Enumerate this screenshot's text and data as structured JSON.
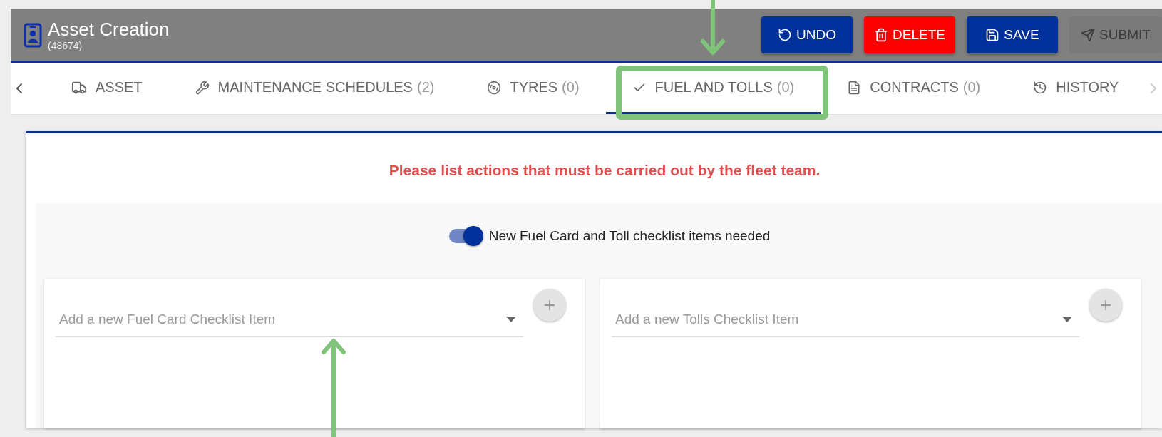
{
  "header": {
    "title": "Asset Creation",
    "subtitle": "(48674)"
  },
  "actions": [
    {
      "kind": "undo",
      "label": "UNDO",
      "disabled": false
    },
    {
      "kind": "delete",
      "label": "DELETE",
      "disabled": false
    },
    {
      "kind": "save",
      "label": "SAVE",
      "disabled": false
    },
    {
      "kind": "submit",
      "label": "SUBMIT",
      "disabled": true
    }
  ],
  "tabs": [
    {
      "label": "ASSET",
      "selected": false
    },
    {
      "label": "MAINTENANCE SCHEDULES",
      "count": "(2)",
      "selected": false
    },
    {
      "label": "TYRES",
      "count": "(0)",
      "selected": false
    },
    {
      "label": "FUEL AND TOLLS",
      "count": "(0)",
      "selected": true
    },
    {
      "label": "CONTRACTS",
      "count": "(0)",
      "selected": false
    },
    {
      "label": "HISTORY",
      "selected": false
    }
  ],
  "message": "Please list actions that must be carried out by the fleet team.",
  "toggle": {
    "label": "New Fuel Card and Toll checklist items needed",
    "on": true
  },
  "checklists": [
    {
      "placeholder": "Add a new Fuel Card Checklist Item"
    },
    {
      "placeholder": "Add a new Tolls Checklist Item"
    }
  ]
}
